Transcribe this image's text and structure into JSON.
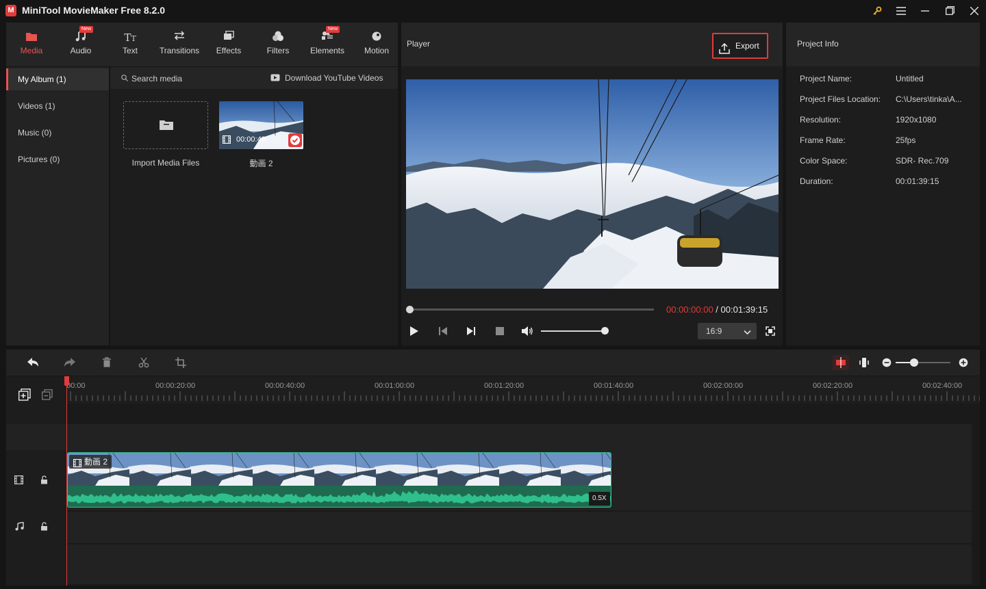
{
  "titlebar": {
    "title": "MiniTool MovieMaker Free 8.2.0",
    "logo_letter": "M"
  },
  "toolbar": {
    "items": [
      {
        "label": "Media",
        "icon": "media-icon",
        "active": true,
        "new": false
      },
      {
        "label": "Audio",
        "icon": "audio-icon",
        "active": false,
        "new": true
      },
      {
        "label": "Text",
        "icon": "text-icon",
        "active": false,
        "new": false
      },
      {
        "label": "Transitions",
        "icon": "transitions-icon",
        "active": false,
        "new": false
      },
      {
        "label": "Effects",
        "icon": "effects-icon",
        "active": false,
        "new": false
      },
      {
        "label": "Filters",
        "icon": "filters-icon",
        "active": false,
        "new": false
      },
      {
        "label": "Elements",
        "icon": "elements-icon",
        "active": false,
        "new": true
      },
      {
        "label": "Motion",
        "icon": "motion-icon",
        "active": false,
        "new": false
      }
    ],
    "new_badge": "New"
  },
  "sidebar": {
    "items": [
      {
        "label": "My Album (1)"
      },
      {
        "label": "Videos (1)"
      },
      {
        "label": "Music (0)"
      },
      {
        "label": "Pictures (0)"
      }
    ]
  },
  "media": {
    "search_placeholder": "Search media",
    "download_label": "Download YouTube Videos",
    "import_label": "Import Media Files",
    "clip_duration": "00:00:49",
    "clip_name": "動画 2"
  },
  "player": {
    "title": "Player",
    "export_label": "Export",
    "current_time": "00:00:00:00",
    "separator": " / ",
    "total_time": "00:01:39:15",
    "aspect_ratio": "16:9",
    "progress": 0.0,
    "volume": 1.0
  },
  "project_info": {
    "title": "Project Info",
    "rows": [
      {
        "key": "Project Name:",
        "value": "Untitled"
      },
      {
        "key": "Project Files Location:",
        "value": "C:\\Users\\tinka\\A..."
      },
      {
        "key": "Resolution:",
        "value": "1920x1080"
      },
      {
        "key": "Frame Rate:",
        "value": "25fps"
      },
      {
        "key": "Color Space:",
        "value": "SDR- Rec.709"
      },
      {
        "key": "Duration:",
        "value": "00:01:39:15"
      }
    ]
  },
  "timeline": {
    "ruler": [
      "00:00",
      "00:00:20:00",
      "00:00:40:00",
      "00:01:00:00",
      "00:01:20:00",
      "00:01:40:00",
      "00:02:00:00",
      "00:02:20:00",
      "00:02:40:00"
    ],
    "clip_name": "動画 2",
    "clip_speed": "0.5X",
    "zoom": 0.4
  },
  "colors": {
    "accent": "#e85451",
    "export_border": "#e23b3b",
    "audio_wave": "#2fbf8c",
    "audio_bg": "#1f6b50"
  }
}
